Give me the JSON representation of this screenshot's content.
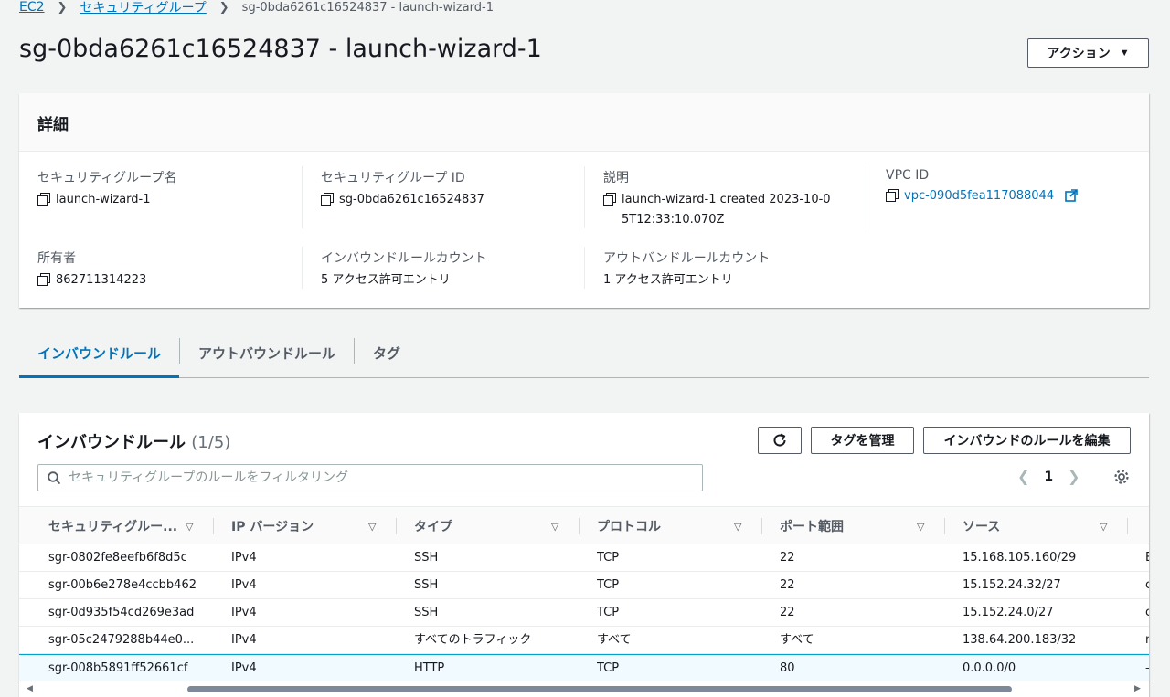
{
  "breadcrumb": {
    "root": "EC2",
    "parent": "セキュリティグループ",
    "current": "sg-0bda6261c16524837 - launch-wizard-1"
  },
  "page_title": "sg-0bda6261c16524837 - launch-wizard-1",
  "actions_label": "アクション",
  "details": {
    "heading": "詳細",
    "sg_name_label": "セキュリティグループ名",
    "sg_name_value": "launch-wizard-1",
    "sg_id_label": "セキュリティグループ ID",
    "sg_id_value": "sg-0bda6261c16524837",
    "description_label": "説明",
    "description_value": "launch-wizard-1 created 2023-10-05T12:33:10.070Z",
    "vpc_label": "VPC ID",
    "vpc_value": "vpc-090d5fea117088044",
    "owner_label": "所有者",
    "owner_value": "862711314223",
    "inbound_count_label": "インバウンドルールカウント",
    "inbound_count_value": "5 アクセス許可エントリ",
    "outbound_count_label": "アウトバンドルールカウント",
    "outbound_count_value": "1 アクセス許可エントリ"
  },
  "tabs": [
    {
      "label": "インバウンドルール",
      "active": true
    },
    {
      "label": "アウトバウンドルール",
      "active": false
    },
    {
      "label": "タグ",
      "active": false
    }
  ],
  "rules": {
    "title": "インバウンドルール",
    "count": "(1/5)",
    "manage_tags_label": "タグを管理",
    "edit_rules_label": "インバウンドのルールを編集",
    "search_placeholder": "セキュリティグループのルールをフィルタリング",
    "page_number": "1",
    "columns": [
      "セキュリティグルー...",
      "IP バージョン",
      "タイプ",
      "プロトコル",
      "ポート範囲",
      "ソース"
    ],
    "rows": [
      {
        "id": "sgr-0802fe8eefb6f8d5c",
        "ip": "IPv4",
        "type": "SSH",
        "protocol": "TCP",
        "port": "22",
        "source": "15.168.105.160/29",
        "extra": "E",
        "selected": false
      },
      {
        "id": "sgr-00b6e278e4ccbb462",
        "ip": "IPv4",
        "type": "SSH",
        "protocol": "TCP",
        "port": "22",
        "source": "15.152.24.32/27",
        "extra": "c",
        "selected": false
      },
      {
        "id": "sgr-0d935f54cd269e3ad",
        "ip": "IPv4",
        "type": "SSH",
        "protocol": "TCP",
        "port": "22",
        "source": "15.152.24.0/27",
        "extra": "c",
        "selected": false
      },
      {
        "id": "sgr-05c2479288b44e0...",
        "ip": "IPv4",
        "type": "すべてのトラフィック",
        "protocol": "すべて",
        "port": "すべて",
        "source": "138.64.200.183/32",
        "extra": "n",
        "selected": false
      },
      {
        "id": "sgr-008b5891ff52661cf",
        "ip": "IPv4",
        "type": "HTTP",
        "protocol": "TCP",
        "port": "80",
        "source": "0.0.0.0/0",
        "extra": "–",
        "selected": true
      }
    ]
  },
  "colors": {
    "link": "#0073bb",
    "selected_border": "#00a1c9",
    "background": "#f2f3f3"
  }
}
